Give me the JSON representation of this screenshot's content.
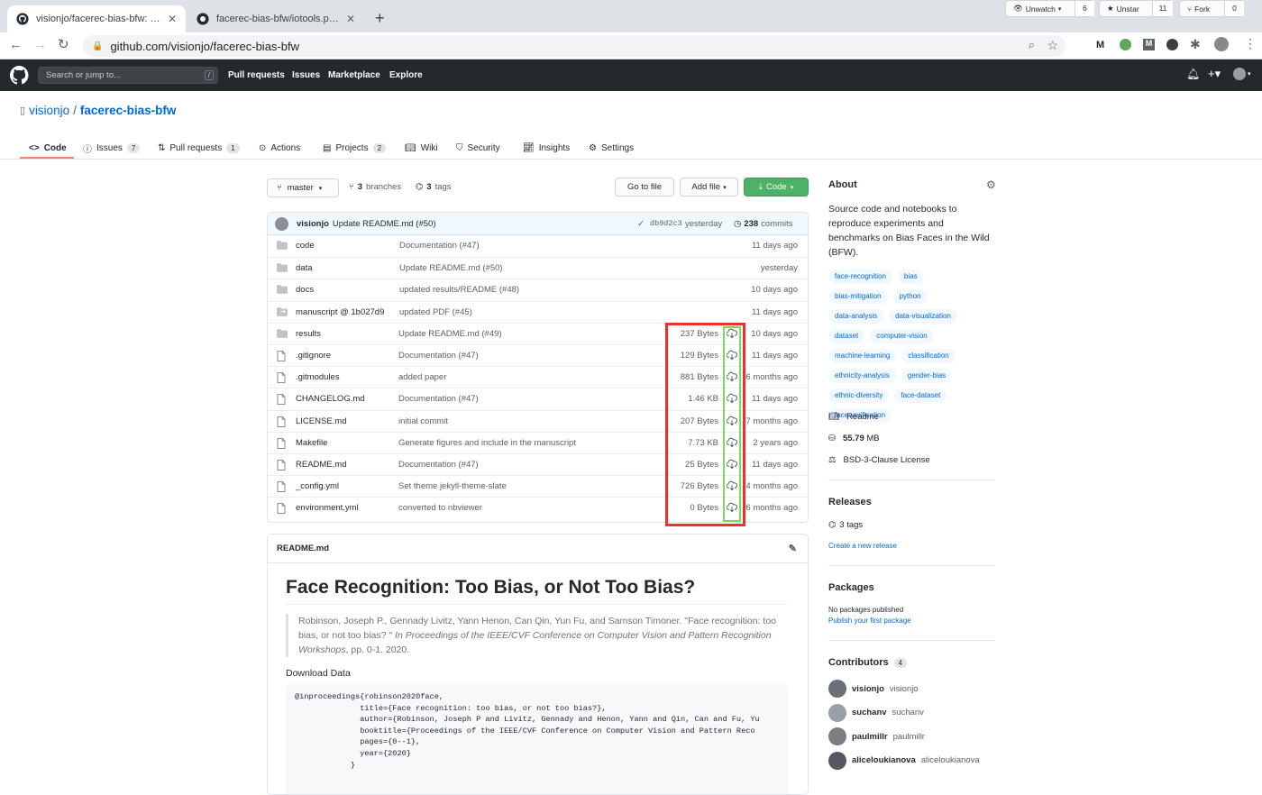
{
  "browser": {
    "tabs": [
      {
        "title": "visionjo/facerec-bias-bfw: Sou",
        "active": true
      },
      {
        "title": "facerec-bias-bfw/iotools.py at",
        "active": false
      }
    ],
    "url": "github.com/visionjo/facerec-bias-bfw"
  },
  "gh_header": {
    "search_placeholder": "Search or jump to...",
    "search_key": "/",
    "nav": [
      "Pull requests",
      "Issues",
      "Marketplace",
      "Explore"
    ]
  },
  "repo": {
    "owner": "visionjo",
    "sep": "/",
    "name": "facerec-bias-bfw",
    "watch_label": "Unwatch",
    "watch_count": "6",
    "star_label": "Unstar",
    "star_count": "11",
    "fork_label": "Fork",
    "fork_count": "0",
    "tabs": [
      {
        "label": "Code",
        "count": ""
      },
      {
        "label": "Issues",
        "count": "7"
      },
      {
        "label": "Pull requests",
        "count": "1"
      },
      {
        "label": "Actions",
        "count": ""
      },
      {
        "label": "Projects",
        "count": "2"
      },
      {
        "label": "Wiki",
        "count": ""
      },
      {
        "label": "Security",
        "count": ""
      },
      {
        "label": "Insights",
        "count": ""
      },
      {
        "label": "Settings",
        "count": ""
      }
    ]
  },
  "filenav": {
    "branch": "master",
    "branches_count": "3",
    "branches_label": "branches",
    "tags_count": "3",
    "tags_label": "tags",
    "goto_file": "Go to file",
    "add_file": "Add file",
    "code_button": "Code"
  },
  "commit": {
    "author": "visionjo",
    "message": "Update README.md (#50)",
    "sha": "db9d2c3",
    "time": "yesterday",
    "commits_count": "238",
    "commits_label": "commits"
  },
  "files": [
    {
      "name": "code",
      "type": "dir",
      "message": "Documentation (#47)",
      "size": "",
      "age": "11 days ago"
    },
    {
      "name": "data",
      "type": "dir",
      "message": "Update README.md (#50)",
      "size": "",
      "age": "yesterday"
    },
    {
      "name": "docs",
      "type": "dir",
      "message": "updated results/README (#48)",
      "size": "",
      "age": "10 days ago"
    },
    {
      "name": "manuscript @ 1b027d9",
      "type": "submodule",
      "message": "updated PDF (#45)",
      "size": "",
      "age": "11 days ago"
    },
    {
      "name": "results",
      "type": "dir",
      "message": "Update README.md (#49)",
      "size": "237 Bytes",
      "age": "10 days ago"
    },
    {
      "name": ".gitignore",
      "type": "file",
      "message": "Documentation (#47)",
      "size": "129 Bytes",
      "age": "11 days ago"
    },
    {
      "name": ".gitmodules",
      "type": "file",
      "message": "added paper",
      "size": "881 Bytes",
      "age": "6 months ago"
    },
    {
      "name": "CHANGELOG.md",
      "type": "file",
      "message": "Documentation (#47)",
      "size": "1.46 KB",
      "age": "11 days ago"
    },
    {
      "name": "LICENSE.md",
      "type": "file",
      "message": "initial commit",
      "size": "207 Bytes",
      "age": "7 months ago"
    },
    {
      "name": "Makefile",
      "type": "file",
      "message": "Generate figures and include in the manuscript",
      "size": "7.73 KB",
      "age": "2 years ago"
    },
    {
      "name": "README.md",
      "type": "file",
      "message": "Documentation (#47)",
      "size": "25 Bytes",
      "age": "11 days ago"
    },
    {
      "name": "_config.yml",
      "type": "file",
      "message": "Set theme jekyll-theme-slate",
      "size": "726 Bytes",
      "age": "4 months ago"
    },
    {
      "name": "environment.yml",
      "type": "file",
      "message": "converted to nbviewer",
      "size": "0 Bytes",
      "age": "6 months ago"
    }
  ],
  "readme": {
    "filename": "README.md",
    "title": "Face Recognition: Too Bias, or Not Too Bias?",
    "citation_plain": "Robinson, Joseph P., Gennady Livitz, Yann Henon, Can Qin, Yun Fu, and Samson Timoner. \"Face recognition: too bias, or not too bias? \"",
    "citation_italic": "In Proceedings of the IEEE/CVF Conference on Computer Vision and Pattern Recognition Workshops",
    "citation_end": ", pp. 0-1. 2020.",
    "download": "Download Data",
    "bibtex": [
      "@inproceedings{robinson2020face,",
      "              title={Face recognition: too bias, or not too bias?},",
      "              author={Robinson, Joseph P and Livitz, Gennady and Henon, Yann and Qin, Can and Fu, Yu",
      "              booktitle={Proceedings of the IEEE/CVF Conference on Computer Vision and Pattern Reco",
      "              pages={0--1},",
      "              year={2020}",
      "            }"
    ]
  },
  "sidebar": {
    "about_title": "About",
    "description": "Source code and notebooks to reproduce experiments and benchmarks on Bias Faces in the Wild (BFW).",
    "topics": [
      "face-recognition",
      "bias",
      "bias-mitigation",
      "python",
      "data-analysis",
      "data-visualization",
      "dataset",
      "computer-vision",
      "machine-learning",
      "classification",
      "ethnicity-analysis",
      "gender-bias",
      "ethnic-diversity",
      "face-dataset",
      "face-verification"
    ],
    "readme_link": "Readme",
    "size_value": "55.79",
    "size_unit": "MB",
    "license": "BSD-3-Clause License",
    "releases_title": "Releases",
    "releases_tags": "3 tags",
    "create_release": "Create a new release",
    "packages_title": "Packages",
    "packages_none": "No packages published",
    "packages_publish": "Publish your first package",
    "contributors_title": "Contributors",
    "contributors_count": "4",
    "contributors": [
      {
        "login": "visionjo",
        "name": "visionjo"
      },
      {
        "login": "suchanv",
        "name": "suchanv"
      },
      {
        "login": "paulmillr",
        "name": "paulmillr"
      },
      {
        "login": "aliceloukianova",
        "name": "aliceloukianova"
      }
    ]
  },
  "colors": {
    "highlight_red": "#e8322a",
    "highlight_green": "#7dd957",
    "header_dark": "#24292e",
    "link_blue": "#0366d6",
    "code_button_green": "#2ea44f"
  }
}
